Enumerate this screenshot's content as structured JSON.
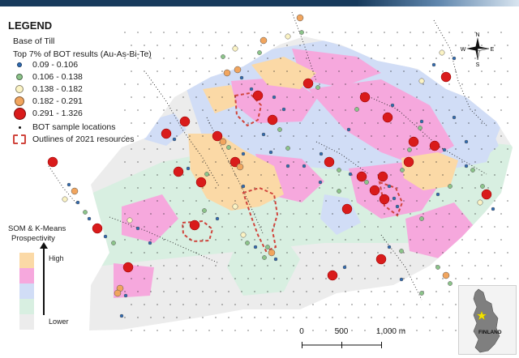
{
  "header": {
    "title": ""
  },
  "legend": {
    "title": "LEGEND",
    "base_layer": "Base of Till",
    "results_title": "Top 7% of BOT results (Au-As-Bi-Te)",
    "classes": [
      {
        "label": "0.09 - 0.106",
        "color": "#2f6bb3",
        "size": 4
      },
      {
        "label": "0.106 - 0.138",
        "color": "#8cc48a",
        "size": 6
      },
      {
        "label": "0.138 - 0.182",
        "color": "#fbf3c4",
        "size": 8
      },
      {
        "label": "0.182 - 0.291",
        "color": "#f1a55e",
        "size": 10
      },
      {
        "label": "0.291 - 1.326",
        "color": "#d91b1b",
        "size": 13
      }
    ],
    "sample_locations": "BOT sample locations",
    "resources": "Outlines of 2021 resources"
  },
  "prospectivity": {
    "title_line1": "SOM & K-Means",
    "title_line2": "Prospectivity",
    "high_label": "High",
    "low_label": "Lower",
    "colors": [
      "#fbd9a6",
      "#f6a8dd",
      "#d1ddf6",
      "#d8efe1",
      "#ececec"
    ]
  },
  "north_arrow": {
    "n": "N",
    "s": "S",
    "e": "E",
    "w": "W"
  },
  "scale_bar": {
    "ticks": [
      "0",
      "500",
      "1,000 m"
    ]
  },
  "inset_map": {
    "label": "FINLAND"
  },
  "map": {
    "samples": [
      [
        65,
        200,
        5
      ],
      [
        85,
        228,
        1
      ],
      [
        92,
        236,
        4
      ],
      [
        80,
        246,
        3
      ],
      [
        96,
        250,
        1
      ],
      [
        105,
        262,
        2
      ],
      [
        120,
        282,
        5
      ],
      [
        110,
        270,
        1
      ],
      [
        130,
        292,
        1
      ],
      [
        140,
        300,
        2
      ],
      [
        158,
        330,
        5
      ],
      [
        148,
        356,
        4
      ],
      [
        145,
        362,
        4
      ],
      [
        155,
        365,
        1
      ],
      [
        150,
        390,
        1
      ],
      [
        160,
        272,
        3
      ],
      [
        170,
        282,
        1
      ],
      [
        185,
        300,
        1
      ],
      [
        205,
        165,
        5
      ],
      [
        215,
        172,
        1
      ],
      [
        220,
        212,
        5
      ],
      [
        232,
        208,
        1
      ],
      [
        228,
        150,
        5
      ],
      [
        248,
        225,
        5
      ],
      [
        255,
        215,
        2
      ],
      [
        268,
        168,
        5
      ],
      [
        275,
        175,
        4
      ],
      [
        282,
        182,
        2
      ],
      [
        290,
        200,
        5
      ],
      [
        296,
        206,
        4
      ],
      [
        300,
        190,
        1
      ],
      [
        240,
        278,
        5
      ],
      [
        252,
        260,
        2
      ],
      [
        268,
        270,
        1
      ],
      [
        290,
        255,
        3
      ],
      [
        300,
        230,
        1
      ],
      [
        275,
        70,
        2
      ],
      [
        280,
        90,
        4
      ],
      [
        293,
        86,
        4
      ],
      [
        298,
        96,
        1
      ],
      [
        310,
        110,
        1
      ],
      [
        318,
        118,
        5
      ],
      [
        336,
        148,
        5
      ],
      [
        345,
        160,
        2
      ],
      [
        325,
        166,
        1
      ],
      [
        334,
        188,
        1
      ],
      [
        355,
        183,
        2
      ],
      [
        338,
        120,
        1
      ],
      [
        350,
        135,
        1
      ],
      [
        370,
        22,
        4
      ],
      [
        372,
        40,
        2
      ],
      [
        355,
        45,
        3
      ],
      [
        325,
        50,
        4
      ],
      [
        320,
        65,
        2
      ],
      [
        290,
        60,
        3
      ],
      [
        380,
        103,
        5
      ],
      [
        392,
        108,
        2
      ],
      [
        406,
        200,
        5
      ],
      [
        396,
        190,
        1
      ],
      [
        418,
        210,
        2
      ],
      [
        432,
        215,
        1
      ],
      [
        446,
        218,
        5
      ],
      [
        452,
        225,
        2
      ],
      [
        462,
        235,
        5
      ],
      [
        472,
        218,
        5
      ],
      [
        480,
        230,
        1
      ],
      [
        474,
        246,
        5
      ],
      [
        486,
        245,
        1
      ],
      [
        490,
        255,
        1
      ],
      [
        428,
        258,
        5
      ],
      [
        418,
        236,
        2
      ],
      [
        505,
        185,
        2
      ],
      [
        510,
        175,
        5
      ],
      [
        518,
        158,
        2
      ],
      [
        520,
        150,
        1
      ],
      [
        536,
        180,
        5
      ],
      [
        548,
        185,
        1
      ],
      [
        504,
        200,
        5
      ],
      [
        496,
        210,
        2
      ],
      [
        478,
        145,
        5
      ],
      [
        484,
        130,
        1
      ],
      [
        450,
        120,
        5
      ],
      [
        440,
        135,
        2
      ],
      [
        430,
        160,
        1
      ],
      [
        520,
        100,
        3
      ],
      [
        535,
        80,
        1
      ],
      [
        550,
        95,
        5
      ],
      [
        545,
        65,
        3
      ],
      [
        560,
        72,
        1
      ],
      [
        560,
        145,
        1
      ],
      [
        575,
        205,
        1
      ],
      [
        583,
        210,
        2
      ],
      [
        595,
        230,
        2
      ],
      [
        600,
        240,
        5
      ],
      [
        592,
        250,
        3
      ],
      [
        608,
        258,
        1
      ],
      [
        470,
        320,
        5
      ],
      [
        480,
        305,
        1
      ],
      [
        495,
        310,
        2
      ],
      [
        520,
        270,
        2
      ],
      [
        540,
        330,
        2
      ],
      [
        550,
        340,
        4
      ],
      [
        555,
        350,
        2
      ],
      [
        410,
        340,
        5
      ],
      [
        425,
        330,
        1
      ],
      [
        495,
        345,
        1
      ],
      [
        520,
        362,
        2
      ],
      [
        300,
        290,
        3
      ],
      [
        305,
        300,
        2
      ],
      [
        315,
        305,
        1
      ],
      [
        330,
        305,
        2
      ],
      [
        335,
        312,
        4
      ],
      [
        326,
        318,
        2
      ],
      [
        340,
        320,
        1
      ],
      [
        355,
        205,
        1
      ],
      [
        375,
        205,
        1
      ],
      [
        395,
        225,
        1
      ],
      [
        540,
        240,
        1
      ],
      [
        555,
        230,
        2
      ],
      [
        575,
        175,
        1
      ]
    ],
    "sample_colors": [
      "#2f6bb3",
      "#8cc48a",
      "#fbf3c4",
      "#f1a55e",
      "#d91b1b"
    ]
  }
}
